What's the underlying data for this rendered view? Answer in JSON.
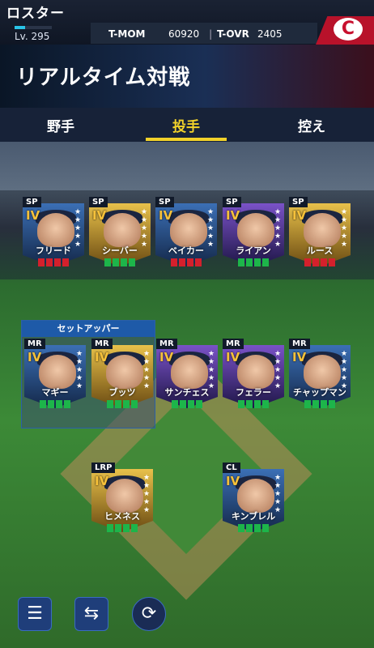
{
  "app": {
    "title": "ロスター"
  },
  "player": {
    "level_label": "Lv. 295"
  },
  "stats": {
    "tmom_label": "T-MOM",
    "tmom_value": "60920",
    "tovr_label": "T-OVR",
    "tovr_value": "2405"
  },
  "page_title": "リアルタイム対戦",
  "tabs": [
    {
      "label": "野手"
    },
    {
      "label": "投手"
    },
    {
      "label": "控え"
    }
  ],
  "setup_label": "セットアッパー",
  "cards": [
    {
      "pos": "SP",
      "rank": "IV",
      "name": "フリード",
      "condition": "red"
    },
    {
      "pos": "SP",
      "rank": "IV",
      "name": "シーバー",
      "condition": "green"
    },
    {
      "pos": "SP",
      "rank": "IV",
      "name": "ベイカー",
      "condition": "red"
    },
    {
      "pos": "SP",
      "rank": "IV",
      "name": "ライアン",
      "condition": "green"
    },
    {
      "pos": "SP",
      "rank": "IV",
      "name": "ルース",
      "condition": "red"
    },
    {
      "pos": "MR",
      "rank": "IV",
      "name": "マギー",
      "condition": "green"
    },
    {
      "pos": "MR",
      "rank": "IV",
      "name": "ブッツ",
      "condition": "green"
    },
    {
      "pos": "MR",
      "rank": "IV",
      "name": "サンチェス",
      "condition": "green"
    },
    {
      "pos": "MR",
      "rank": "IV",
      "name": "フェラー",
      "condition": "green"
    },
    {
      "pos": "MR",
      "rank": "IV",
      "name": "チャップマン",
      "condition": "green"
    },
    {
      "pos": "LRP",
      "rank": "IV",
      "name": "ヒメネス",
      "condition": "green"
    },
    {
      "pos": "CL",
      "rank": "IV",
      "name": "キンブレル",
      "condition": "green"
    }
  ],
  "bottom": {
    "menu_icon": "menu-icon",
    "swap_icon": "player-swap-icon",
    "refresh_icon": "refresh-icon"
  },
  "colors": {
    "accent": "#f2d22a",
    "team": "#c8102e",
    "condition_green": "#1db54a",
    "condition_red": "#d4202c"
  }
}
